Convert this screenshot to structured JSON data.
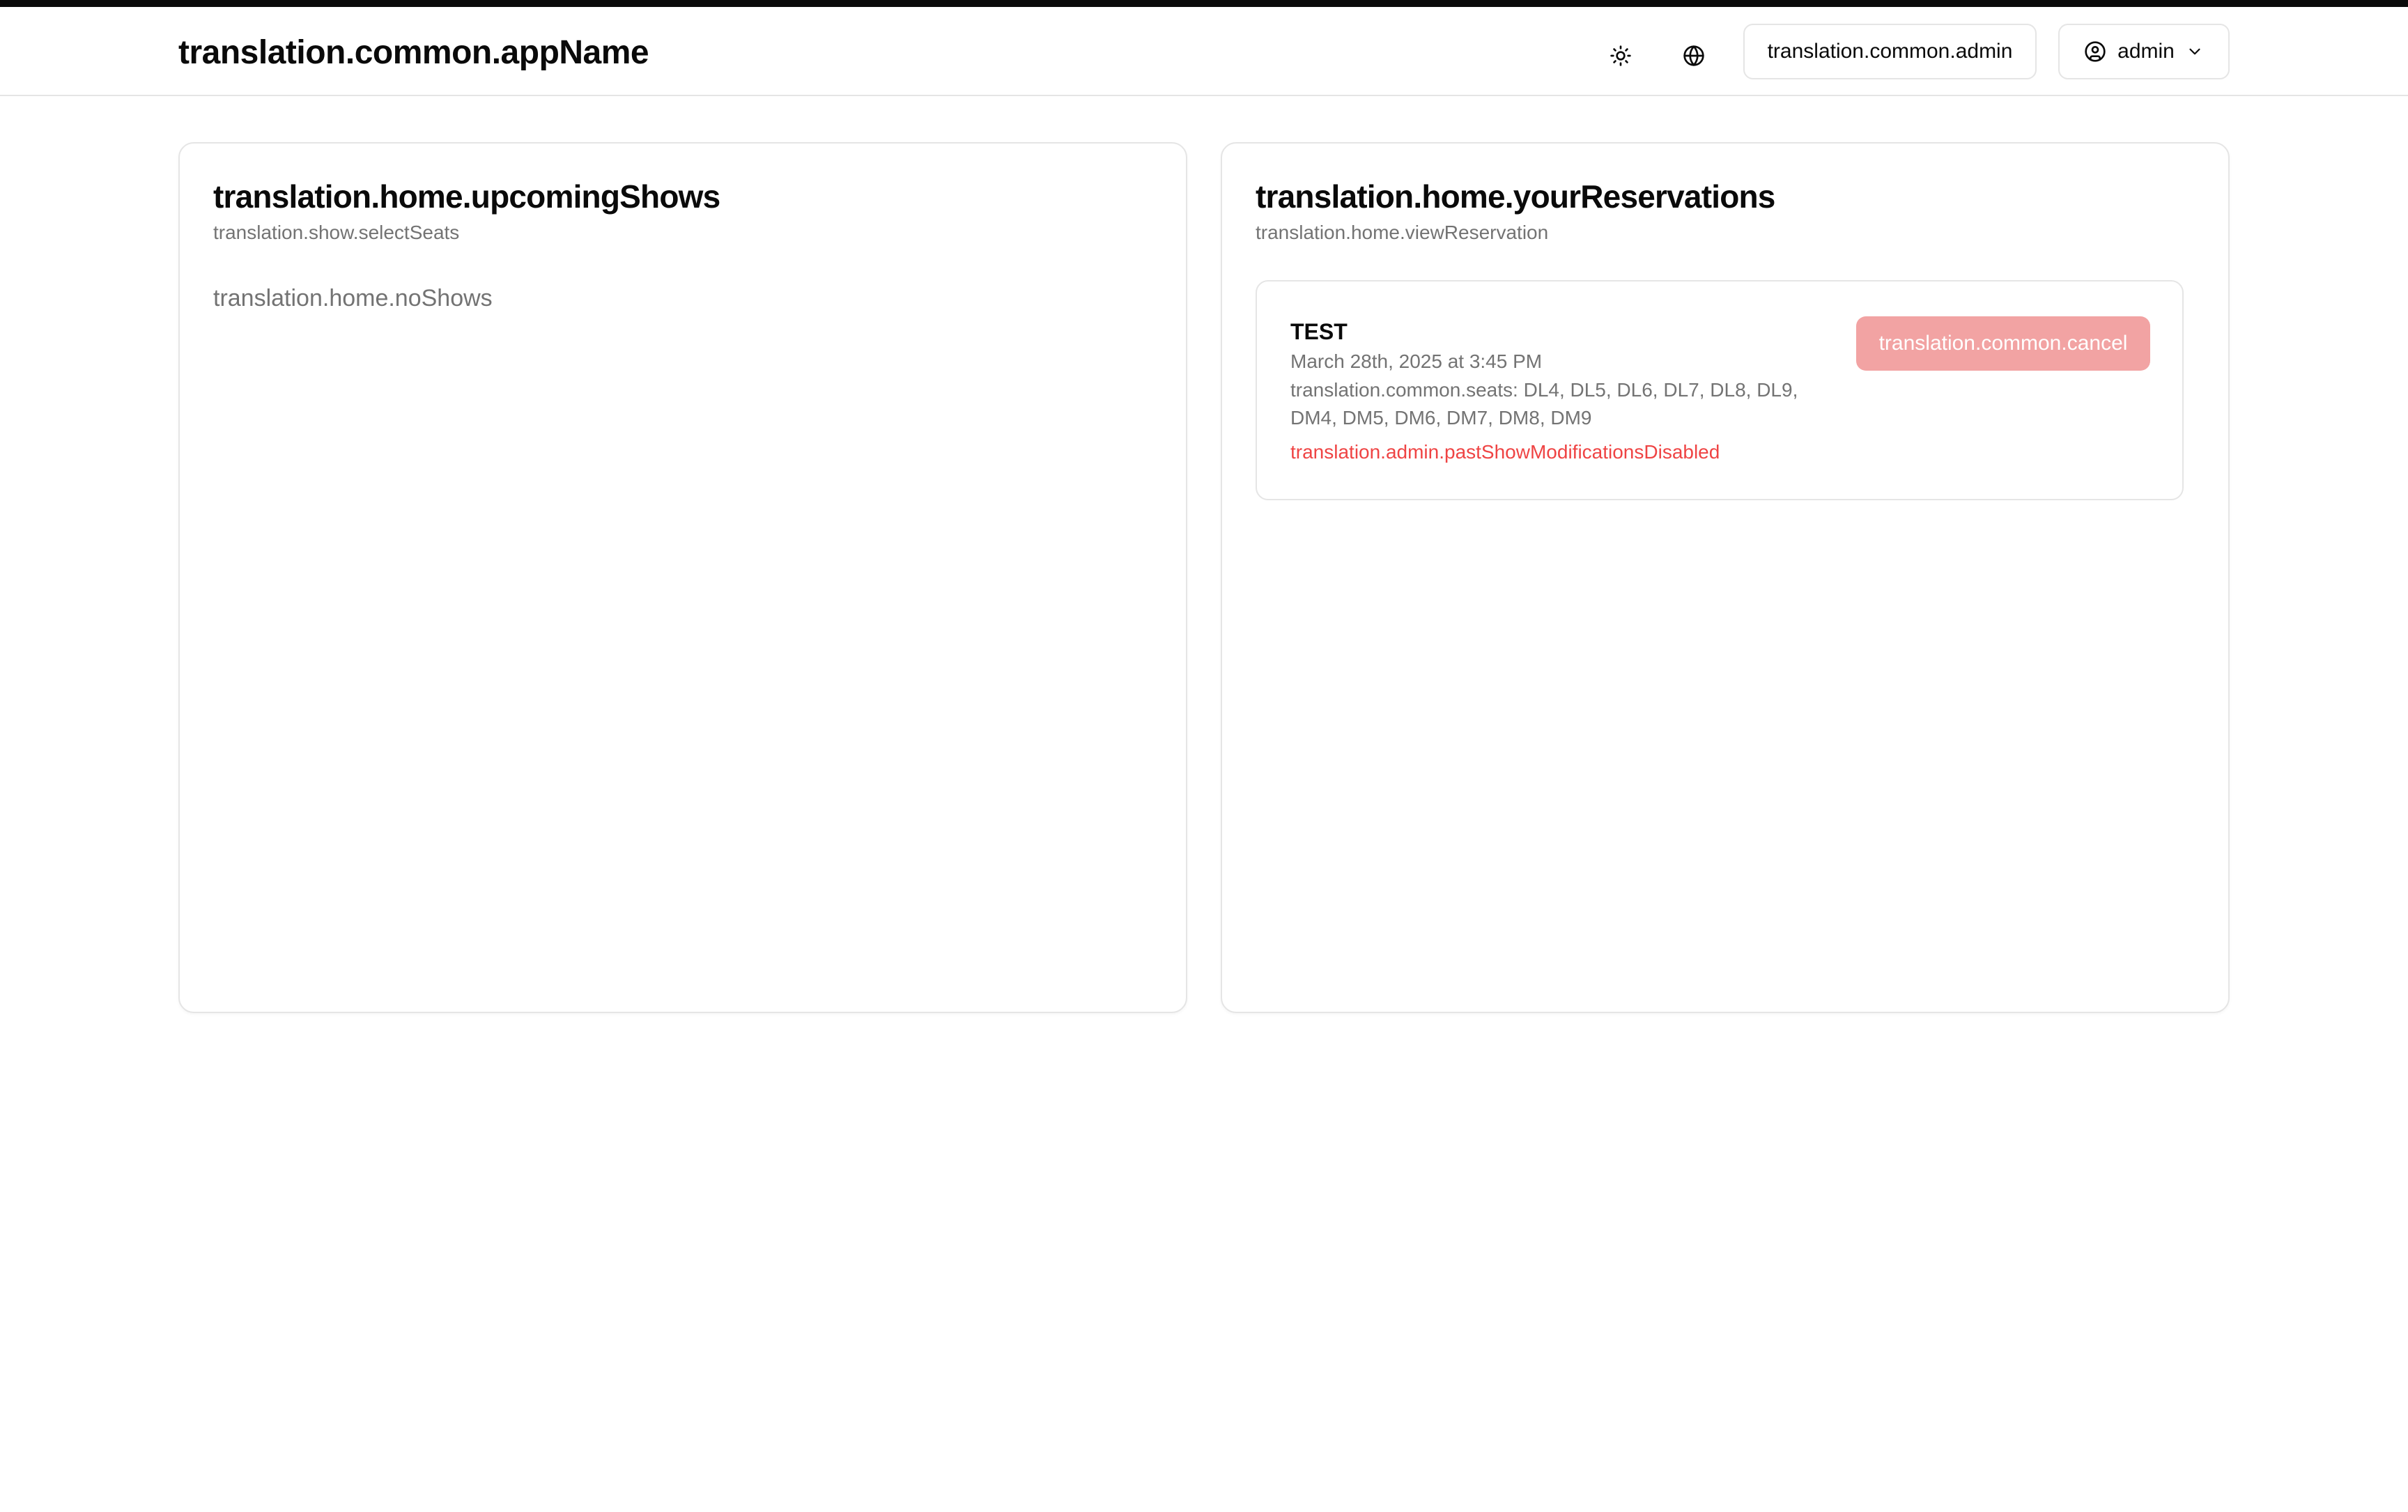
{
  "header": {
    "app_name": "translation.common.appName",
    "theme_toggle_icon": "sun-icon",
    "language_icon": "globe-icon",
    "admin_label": "translation.common.admin",
    "user_label": "admin",
    "user_icon": "user-circle-icon",
    "user_menu_icon": "chevron-down-icon"
  },
  "upcoming_shows": {
    "title": "translation.home.upcomingShows",
    "description": "translation.show.selectSeats",
    "empty_message": "translation.home.noShows"
  },
  "reservations": {
    "title": "translation.home.yourReservations",
    "description": "translation.home.viewReservation",
    "items": [
      {
        "show_name": "TEST",
        "date": "March 28th, 2025 at 3:45 PM",
        "seats": "translation.common.seats: DL4, DL5, DL6, DL7, DL8, DL9, DM4, DM5, DM6, DM7, DM8, DM9",
        "warning": "translation.admin.pastShowModificationsDisabled",
        "cancel_label": "translation.common.cancel",
        "cancel_disabled": true
      }
    ]
  },
  "colors": {
    "accent_destructive": "#ef4444",
    "destructive_disabled": "#f2a3a3",
    "border": "#e5e5e5",
    "muted_text": "#737373"
  }
}
